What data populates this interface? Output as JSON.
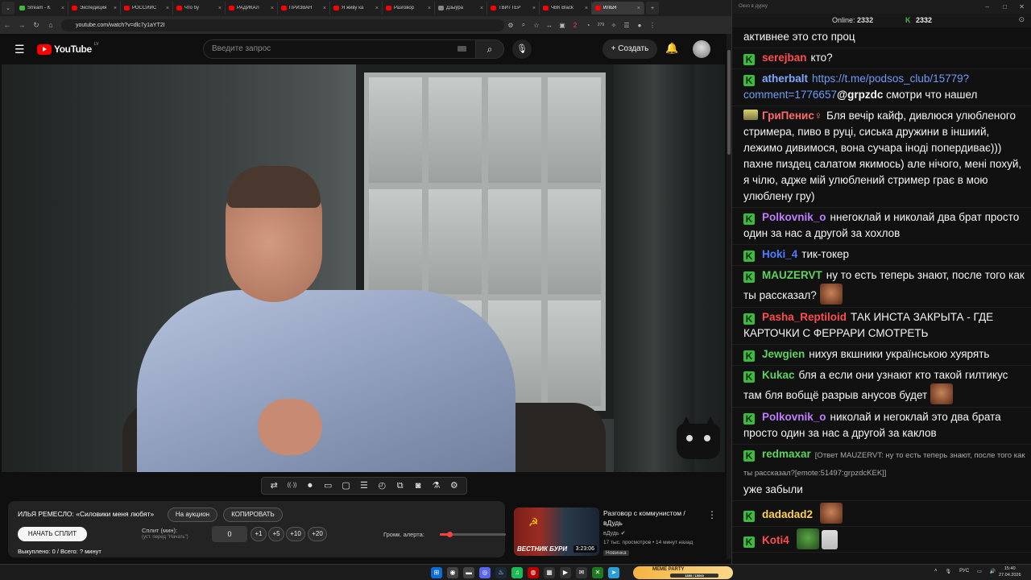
{
  "browser": {
    "tabs": [
      {
        "title": "Stream - K",
        "color": "#3dbb3d"
      },
      {
        "title": "Экспедиция",
        "color": "#ff0000"
      },
      {
        "title": "РОССИЙС",
        "color": "#ff0000"
      },
      {
        "title": "Что бу",
        "color": "#ff0000"
      },
      {
        "title": "РАДИКАЛ",
        "color": "#ff0000"
      },
      {
        "title": "ПРИЗВАН",
        "color": "#ff0000"
      },
      {
        "title": "Я живу ка",
        "color": "#ff0000"
      },
      {
        "title": "Разговор",
        "color": "#ff0000"
      },
      {
        "title": "Дзыўра",
        "color": "#888888"
      },
      {
        "title": "ТВИТТЕР",
        "color": "#ff0000"
      },
      {
        "title": "ЧВК Black",
        "color": "#ff0000"
      },
      {
        "title": "ИЛЬЯ",
        "color": "#ff0000",
        "active": true
      }
    ],
    "new_tab": "+",
    "url": "youtube.com/watch?v=dlc7y1aYT2I",
    "ext_badge_1": "2",
    "ext_badge_2": "279"
  },
  "youtube": {
    "logo": "YouTube",
    "region": "LV",
    "search_placeholder": "Введите запрос",
    "create_label": "Создать"
  },
  "player_toolbar": [
    "loop-icon",
    "broadcast-icon",
    "screen-record-icon",
    "clip-icon",
    "frame-icon",
    "subtitles-icon",
    "speed-icon",
    "pip-icon",
    "screenshot-icon",
    "flask-icon",
    "settings-icon"
  ],
  "panel": {
    "title": "ИЛЬЯ РЕМЕСЛО: «Силовики меня любят»",
    "auction": "На аукцион",
    "copy": "КОПИРОВАТЬ",
    "start_split": "НАЧАТЬ СПЛИТ",
    "split_label": "Сплит (мин):",
    "split_hint": "(уст. перед \"Начать\")",
    "split_value": "0",
    "steps": [
      "+1",
      "+5",
      "+10",
      "+20"
    ],
    "alert_volume_label": "Громк. алерта:",
    "alert_volume": 0.15,
    "bought": "Выкуплено: 0 / Всего: ? минут"
  },
  "recommended": {
    "title": "Разговор с коммунистом / вДудь",
    "channel": "вДудь",
    "meta": "17 тыс. просмотров • 14 минут назад",
    "badge": "Новинка",
    "thumb_caption": "ВЕСТНИК БУРИ",
    "duration": "3:23:06"
  },
  "chat": {
    "window_title": "Окно в дурку",
    "online_label": "Online:",
    "online_value": "2332",
    "online_value_2": "2332",
    "messages": [
      {
        "nick": "",
        "color": "#ffffff",
        "text": "активнее это сто проц",
        "badge": "none"
      },
      {
        "nick": "serejban",
        "color": "#ff4d4d",
        "text": "кто?",
        "badge": "k"
      },
      {
        "nick": "atherbalt",
        "color": "#7fa7ff",
        "link": "https://t.me/podsos_club/15779?comment=1776657",
        "mention": "@grpzdc",
        "text": " смотри что нашел",
        "badge": "k"
      },
      {
        "nick": "ГриПенис♀",
        "color": "#ff6a6a",
        "text": "Бля вечір кайф, дивлюся улюбленого стримера, пиво в руці, сиська дружини в іншиий, лежимо дивимося, вона сучара іноді попердиває))) пахне пиздец салатом якимось) але нічого, мені похуй, я чілю, адже мій улюблений стример грає в мою улюблену гру)",
        "badge": "img"
      },
      {
        "nick": "Polkovnik_o",
        "color": "#c07cff",
        "text": "ннегоклай и николай два брат просто один за нас а другой за хохлов",
        "badge": "k"
      },
      {
        "nick": "Hoki_4",
        "color": "#4d7dff",
        "text": "тик-токер",
        "badge": "k"
      },
      {
        "nick": "MAUZERVT",
        "color": "#5fd35f",
        "text": "ну то есть теперь знают, после того как ты рассказал?",
        "badge": "k",
        "emote": "face"
      },
      {
        "nick": "Pasha_Reptiloid",
        "color": "#ff4d4d",
        "text": "ТАК ИНСТА ЗАКРЫТА - ГДЕ КАРТОЧКИ С ФЕРРАРИ СМОТРЕТЬ",
        "badge": "k"
      },
      {
        "nick": "Jewgien",
        "color": "#5fd35f",
        "text": "нихуя вкшники українською хуярять",
        "badge": "k"
      },
      {
        "nick": "Kukac",
        "color": "#5fd35f",
        "text": "бля а если они узнают кто такой гилтикус там бля вобщё разрыв анусов будет",
        "badge": "k",
        "emote": "face"
      },
      {
        "nick": "Polkovnik_o",
        "color": "#c07cff",
        "text": "николай и негоклай это два брата просто один за нас а другой за каклов",
        "badge": "k"
      },
      {
        "nick": "redmaxar",
        "color": "#5fd35f",
        "reply": "[Ответ MAUZERVT: ну то есть теперь знают, после того как ты рассказал?[emote:51497:grpzdcKEK]]",
        "text": "уже забыли",
        "badge": "k"
      },
      {
        "nick": "dadadad2",
        "color": "#ffd24d",
        "text": "",
        "badge": "k",
        "emote": "face"
      },
      {
        "nick": "Koti4",
        "color": "#ff4d4d",
        "text": "",
        "badge": "k",
        "emote": "frog"
      }
    ]
  },
  "taskbar": {
    "meme_party": "MEME PARTY",
    "meme_progress": "1850 / 15000",
    "lang": "РУС",
    "time": "15:40",
    "date": "27.04.2026"
  }
}
